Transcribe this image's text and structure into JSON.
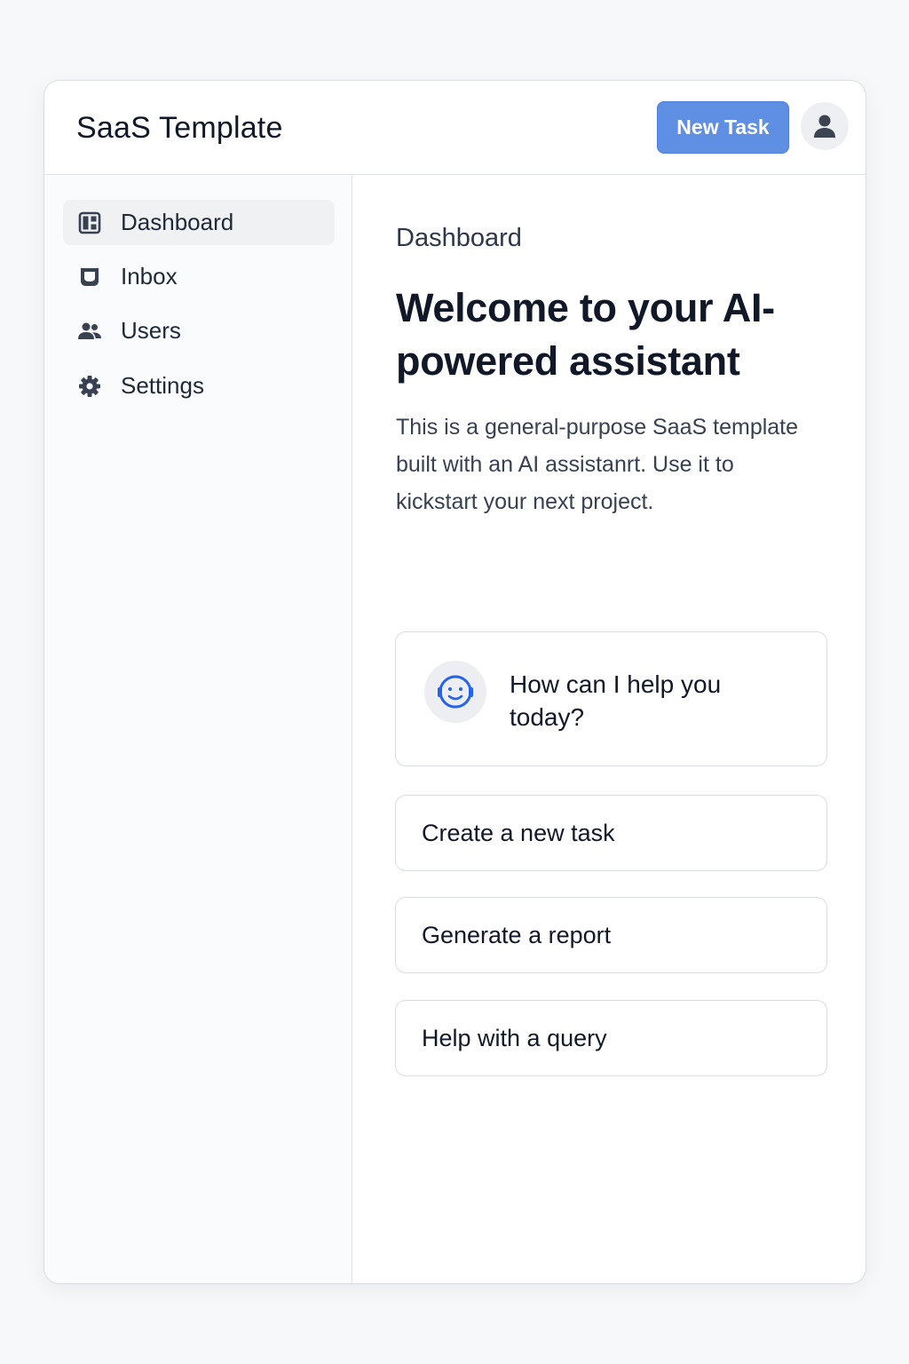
{
  "header": {
    "app_title": "SaaS Template",
    "new_task_label": "New Task",
    "avatar_icon": "user-icon"
  },
  "sidebar": {
    "items": [
      {
        "label": "Dashboard",
        "icon": "dashboard-icon",
        "active": true
      },
      {
        "label": "Inbox",
        "icon": "inbox-icon",
        "active": false
      },
      {
        "label": "Users",
        "icon": "users-icon",
        "active": false
      },
      {
        "label": "Settings",
        "icon": "gear-icon",
        "active": false
      }
    ]
  },
  "main": {
    "breadcrumb": "Dashboard",
    "title": "Welcome to your AI-powered assistant",
    "description": "This is a general-purpose SaaS template built with an AI assistanrt. Use it to kickstart your next project.",
    "assistant_prompt": "How can I help you today?",
    "assistant_icon": "robot-face-icon",
    "actions": [
      {
        "label": "Create a new task"
      },
      {
        "label": "Generate a report"
      },
      {
        "label": "Help with a query"
      }
    ]
  },
  "colors": {
    "accent": "#5e8fe3",
    "assistant_icon": "#2563eb",
    "icon": "#374151",
    "border": "#dadde2"
  }
}
